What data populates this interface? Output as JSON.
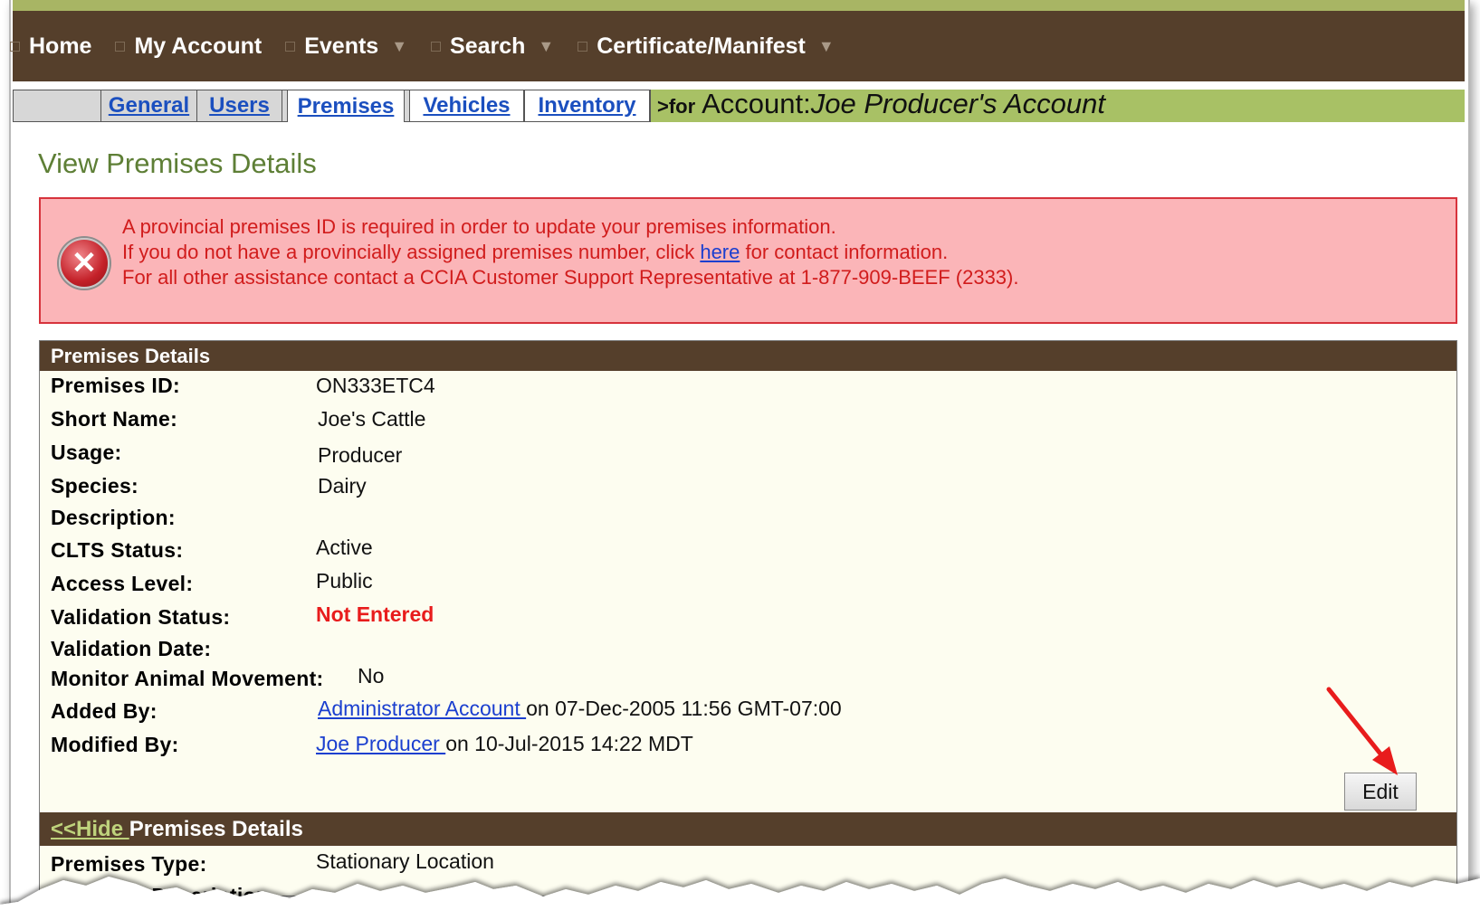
{
  "nav": {
    "items": [
      {
        "label": "Home",
        "has_caret": false
      },
      {
        "label": "My Account",
        "has_caret": false
      },
      {
        "label": "Events",
        "has_caret": true
      },
      {
        "label": "Search",
        "has_caret": true
      },
      {
        "label": "Certificate/Manifest",
        "has_caret": true
      }
    ]
  },
  "tabs": {
    "general": "General",
    "users": "Users",
    "premises": "Premises",
    "vehicles": "Vehicles",
    "inventory": "Inventory",
    "for_prefix": ">for",
    "account_label": "Account:",
    "account_name": "Joe Producer's Account"
  },
  "page_title": "View Premises Details",
  "alert": {
    "line1": "A provincial premises ID is required in order to update your premises information.",
    "line2_before": "If you do not have a provincially assigned premises number, click ",
    "line2_link": "here",
    "line2_after": " for contact information.",
    "line3": "For all other assistance contact a CCIA Customer Support Representative at 1-877-909-BEEF (2333)."
  },
  "details": {
    "header": "Premises Details",
    "premises_id_label": "Premises ID:",
    "premises_id": "ON333ETC4",
    "short_name_label": "Short Name:",
    "short_name": "Joe's Cattle",
    "usage_label": "Usage:",
    "usage": "Producer",
    "species_label": "Species:",
    "species": "Dairy",
    "description_label": "Description:",
    "description": "",
    "clts_label": "CLTS Status:",
    "clts": "Active",
    "access_label": "Access Level:",
    "access": "Public",
    "validation_status_label": "Validation Status:",
    "validation_status": "Not Entered",
    "validation_date_label": "Validation Date:",
    "validation_date": "",
    "monitor_label": "Monitor Animal Movement:",
    "monitor": "No",
    "added_by_label": "Added By:",
    "added_by_link": "Administrator Account ",
    "added_by_suffix": "on 07-Dec-2005 11:56 GMT-07:00",
    "modified_by_label": "Modified By:",
    "modified_by_link": "Joe Producer ",
    "modified_by_suffix": "on 10-Jul-2015 14:22 MDT",
    "edit_button": "Edit"
  },
  "details2": {
    "hide_link": "<<Hide ",
    "header": "Premises Details",
    "type_label": "Premises Type:",
    "type_value": "Stationary Location",
    "partial_label": "Premises Description"
  },
  "colors": {
    "nav_bg": "#553f2b",
    "accent_green": "#a8c165",
    "alert_bg": "#fbb5b8",
    "alert_text": "#d11c1c",
    "link": "#1b3fcf",
    "status_red": "#e81c1c",
    "annotation_arrow": "#e81c1c"
  }
}
